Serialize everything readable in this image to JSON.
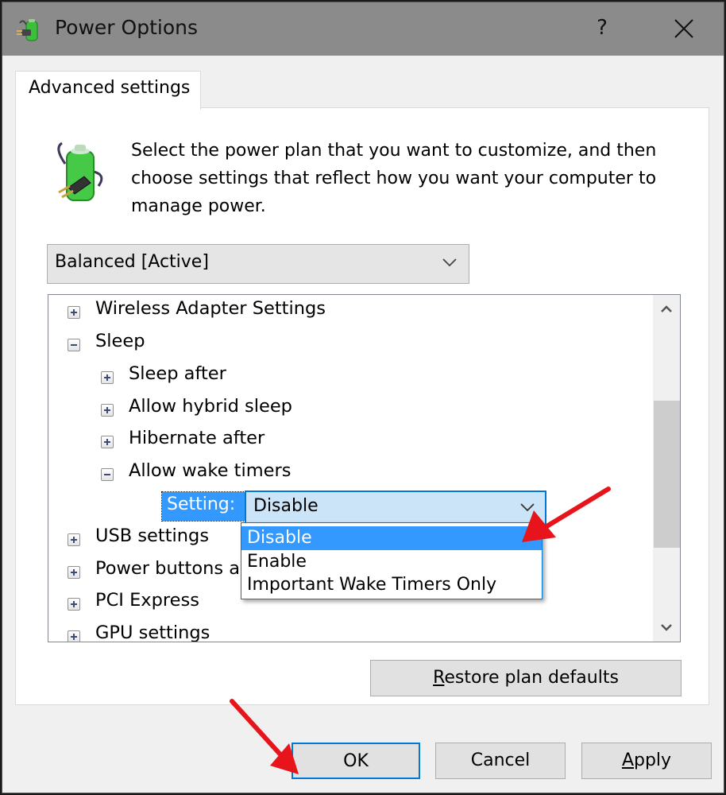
{
  "window": {
    "title": "Power Options",
    "help_label": "?",
    "close_label": "close"
  },
  "tabs": [
    {
      "label": "Advanced settings",
      "active": true
    }
  ],
  "description": "Select the power plan that you want to customize, and then choose settings that reflect how you want your computer to manage power.",
  "plan_select": {
    "value": "Balanced [Active]"
  },
  "tree": {
    "items": [
      {
        "label": "Wireless Adapter Settings",
        "expanded": false,
        "level": 0
      },
      {
        "label": "Sleep",
        "expanded": true,
        "level": 0
      },
      {
        "label": "Sleep after",
        "expanded": false,
        "level": 1
      },
      {
        "label": "Allow hybrid sleep",
        "expanded": false,
        "level": 1
      },
      {
        "label": "Hibernate after",
        "expanded": false,
        "level": 1
      },
      {
        "label": "Allow wake timers",
        "expanded": true,
        "level": 1
      },
      {
        "label": "USB settings",
        "expanded": false,
        "level": 0
      },
      {
        "label": "Power buttons and lid",
        "expanded": false,
        "level": 0
      },
      {
        "label": "PCI Express",
        "expanded": false,
        "level": 0
      },
      {
        "label": "GPU settings",
        "expanded": false,
        "level": 0
      }
    ],
    "setting_label": "Setting:",
    "setting_value": "Disable",
    "scroll_position": 0.45
  },
  "dropdown": {
    "options": [
      "Disable",
      "Enable",
      "Important Wake Timers Only"
    ],
    "selected": "Disable"
  },
  "buttons": {
    "restore": {
      "prefix": "R",
      "rest": "estore plan defaults"
    },
    "ok": "OK",
    "cancel": "Cancel",
    "apply": {
      "prefix": "A",
      "rest": "pply"
    }
  },
  "annotations": {
    "arrow_color": "#e8141b"
  }
}
